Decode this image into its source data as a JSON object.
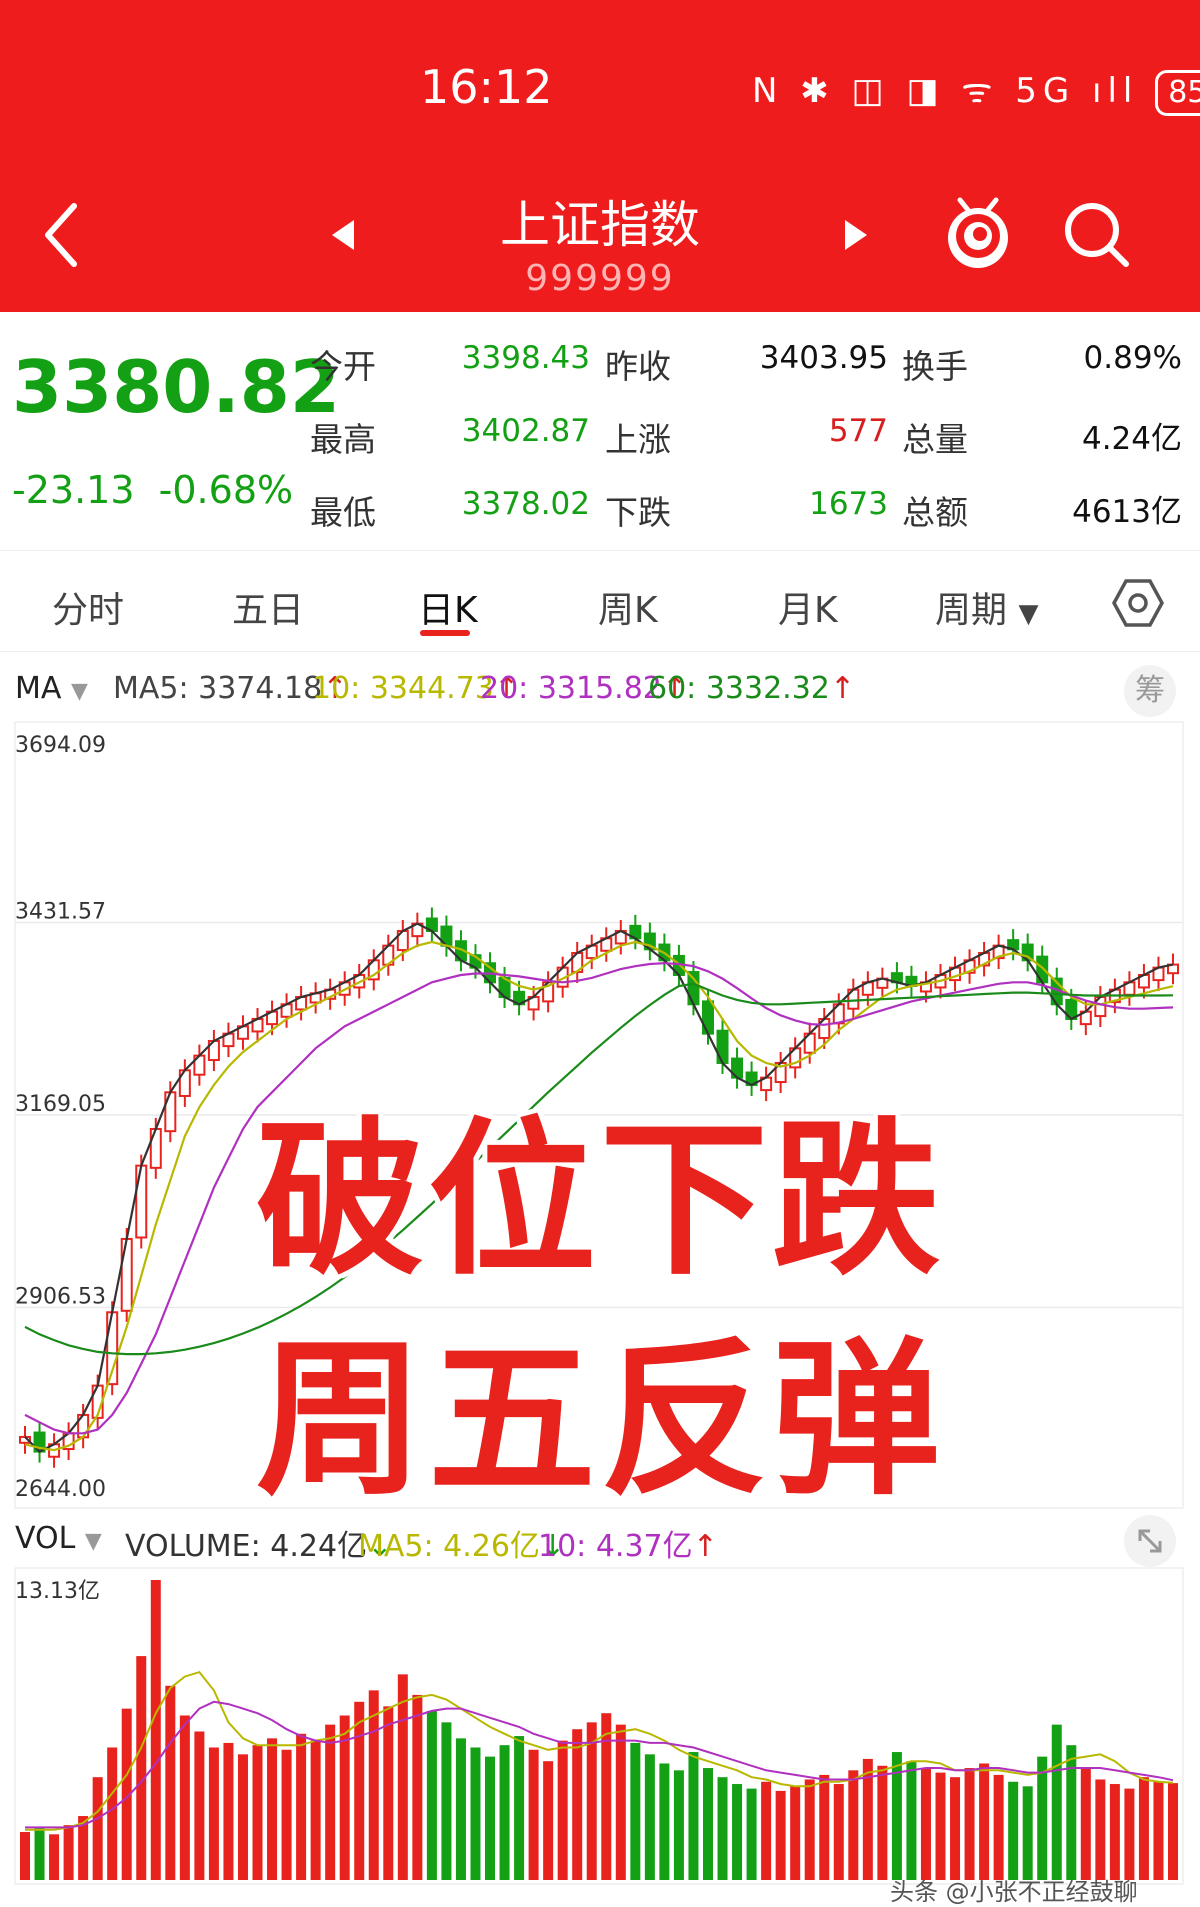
{
  "status_bar": {
    "time": "16:12",
    "icons": "N ✱ ◫ ◨ ᯤ 5G ıll",
    "battery": "85"
  },
  "header": {
    "title": "上证指数",
    "code": "999999"
  },
  "quote": {
    "price": "3380.82",
    "change": "-23.13",
    "change_pct": "-0.68%",
    "rows": [
      {
        "l1": "今开",
        "v1": "3398.43",
        "c1": "green",
        "l2": "昨收",
        "v2": "3403.95",
        "c2": "black",
        "l3": "换手",
        "v3": "0.89%",
        "c3": "black"
      },
      {
        "l1": "最高",
        "v1": "3402.87",
        "c1": "green",
        "l2": "上涨",
        "v2": "577",
        "c2": "red",
        "l3": "总量",
        "v3": "4.24亿",
        "c3": "black"
      },
      {
        "l1": "最低",
        "v1": "3378.02",
        "c1": "green",
        "l2": "下跌",
        "v2": "1673",
        "c2": "green",
        "l3": "总额",
        "v3": "4613亿",
        "c3": "black"
      }
    ]
  },
  "tabs": [
    {
      "label": "分时",
      "active": false
    },
    {
      "label": "五日",
      "active": false
    },
    {
      "label": "日K",
      "active": true
    },
    {
      "label": "周K",
      "active": false
    },
    {
      "label": "月K",
      "active": false
    },
    {
      "label": "周期",
      "active": false
    }
  ],
  "ma_legend": {
    "selector": "MA",
    "items": [
      {
        "text": "MA5: 3374.18",
        "color": "#444444"
      },
      {
        "text": "10: 3344.73",
        "color": "#b8b800"
      },
      {
        "text": "20: 3315.82",
        "color": "#b030c0"
      },
      {
        "text": "60: 3332.32",
        "color": "#1a8a1a"
      }
    ],
    "chip_button": "筹"
  },
  "vol_legend": {
    "selector": "VOL",
    "items": [
      {
        "text": "VOLUME: 4.24亿",
        "color": "#333333",
        "arrow": "↓",
        "arrow_color": "#14a014"
      },
      {
        "text": "MA5: 4.26亿",
        "color": "#b8b800",
        "arrow": "↓",
        "arrow_color": "#14a014"
      },
      {
        "text": "10: 4.37亿",
        "color": "#b030c0",
        "arrow": "↑",
        "arrow_color": "#d61f1f"
      }
    ]
  },
  "overlay": {
    "line1": "破位下跌",
    "line2": "周五反弹"
  },
  "watermark": "头条 @小张不正经鼓聊",
  "colors": {
    "up": "#e8231e",
    "down": "#14a014",
    "ma5": "#333333",
    "ma10": "#b8b800",
    "ma20": "#b030c0",
    "ma60": "#1a8a1a"
  },
  "chart_data": [
    {
      "type": "candlestick",
      "title": "",
      "y_ticks": [
        "3694.09",
        "3431.57",
        "3169.05",
        "2906.53",
        "2644.00"
      ],
      "ylim": [
        2644.0,
        3694.09
      ],
      "series": [
        {
          "name": "MA5",
          "values": [
            2730,
            2710,
            2720,
            2735,
            2760,
            2800,
            2900,
            3000,
            3100,
            3150,
            3200,
            3230,
            3250,
            3270,
            3280,
            3290,
            3300,
            3310,
            3320,
            3330,
            3335,
            3340,
            3350,
            3360,
            3380,
            3400,
            3420,
            3430,
            3420,
            3400,
            3380,
            3370,
            3350,
            3330,
            3320,
            3330,
            3350,
            3370,
            3390,
            3400,
            3410,
            3420,
            3410,
            3395,
            3380,
            3360,
            3320,
            3280,
            3240,
            3220,
            3210,
            3220,
            3240,
            3260,
            3280,
            3300,
            3320,
            3340,
            3350,
            3355,
            3350,
            3345,
            3350,
            3360,
            3370,
            3380,
            3390,
            3400,
            3395,
            3380,
            3350,
            3320,
            3300,
            3310,
            3330,
            3340,
            3350,
            3360,
            3370,
            3374.18
          ]
        },
        {
          "name": "MA10",
          "values": [
            2720,
            2715,
            2712,
            2718,
            2730,
            2760,
            2820,
            2880,
            2950,
            3020,
            3080,
            3140,
            3180,
            3210,
            3235,
            3255,
            3270,
            3285,
            3300,
            3310,
            3320,
            3330,
            3340,
            3350,
            3360,
            3375,
            3390,
            3400,
            3405,
            3400,
            3395,
            3385,
            3370,
            3355,
            3345,
            3340,
            3345,
            3355,
            3365,
            3380,
            3390,
            3400,
            3405,
            3400,
            3390,
            3375,
            3355,
            3330,
            3300,
            3270,
            3250,
            3240,
            3235,
            3240,
            3250,
            3265,
            3285,
            3300,
            3315,
            3330,
            3340,
            3345,
            3348,
            3352,
            3358,
            3365,
            3375,
            3385,
            3390,
            3385,
            3370,
            3350,
            3330,
            3320,
            3320,
            3325,
            3330,
            3335,
            3340,
            3344.73
          ]
        },
        {
          "name": "MA20",
          "values": [
            2760,
            2750,
            2740,
            2735,
            2735,
            2740,
            2760,
            2790,
            2830,
            2870,
            2920,
            2970,
            3020,
            3070,
            3110,
            3150,
            3180,
            3200,
            3220,
            3240,
            3260,
            3275,
            3290,
            3300,
            3310,
            3320,
            3330,
            3340,
            3350,
            3355,
            3360,
            3362,
            3362,
            3360,
            3358,
            3355,
            3352,
            3350,
            3352,
            3356,
            3362,
            3368,
            3372,
            3375,
            3376,
            3375,
            3372,
            3365,
            3355,
            3342,
            3328,
            3315,
            3305,
            3298,
            3293,
            3292,
            3295,
            3300,
            3306,
            3312,
            3318,
            3324,
            3328,
            3332,
            3336,
            3340,
            3344,
            3348,
            3350,
            3350,
            3346,
            3340,
            3332,
            3325,
            3320,
            3316,
            3314,
            3314,
            3315,
            3315.82
          ]
        },
        {
          "name": "MA60",
          "values": [
            2880,
            2870,
            2862,
            2855,
            2850,
            2846,
            2844,
            2843,
            2843,
            2844,
            2846,
            2849,
            2853,
            2858,
            2864,
            2871,
            2879,
            2888,
            2898,
            2909,
            2921,
            2934,
            2948,
            2963,
            2979,
            2995,
            3012,
            3030,
            3048,
            3067,
            3086,
            3105,
            3124,
            3143,
            3162,
            3181,
            3200,
            3218,
            3236,
            3254,
            3271,
            3288,
            3304,
            3319,
            3333,
            3345,
            3348,
            3340,
            3332,
            3326,
            3322,
            3320,
            3320,
            3321,
            3322,
            3323,
            3324,
            3325,
            3326,
            3327,
            3328,
            3329,
            3330,
            3331,
            3332,
            3333,
            3334,
            3335,
            3336,
            3336,
            3335,
            3334,
            3333,
            3332,
            3332,
            3332,
            3332,
            3332,
            3332,
            3332.32
          ]
        }
      ]
    },
    {
      "type": "bar",
      "title": "",
      "y_ticks": [
        "13.13亿"
      ],
      "ylim": [
        0,
        13.13
      ],
      "series": [
        {
          "name": "VOLUME",
          "values": [
            2.1,
            2.3,
            2.0,
            2.4,
            2.8,
            4.5,
            5.8,
            7.5,
            9.8,
            13.13,
            8.5,
            7.2,
            6.5,
            5.8,
            6.0,
            5.5,
            5.9,
            6.2,
            5.7,
            6.4,
            6.1,
            6.8,
            7.2,
            7.8,
            8.3,
            7.6,
            9.0,
            8.1,
            7.4,
            6.9,
            6.2,
            5.8,
            5.4,
            5.9,
            6.3,
            5.7,
            5.2,
            6.1,
            6.6,
            6.9,
            7.3,
            6.8,
            6.0,
            5.5,
            5.1,
            4.8,
            5.6,
            4.9,
            4.5,
            4.2,
            4.0,
            4.3,
            3.9,
            4.1,
            4.4,
            4.6,
            4.2,
            4.8,
            5.3,
            5.0,
            5.6,
            5.2,
            4.9,
            4.7,
            4.5,
            4.9,
            5.1,
            4.6,
            4.3,
            4.1,
            5.4,
            6.8,
            5.9,
            4.9,
            4.4,
            4.2,
            4.0,
            4.5,
            4.3,
            4.24
          ]
        },
        {
          "name": "MA5",
          "values": [
            2.2,
            2.2,
            2.2,
            2.3,
            2.5,
            3.0,
            3.8,
            4.6,
            5.8,
            7.3,
            8.4,
            8.9,
            9.1,
            8.3,
            6.9,
            6.2,
            5.9,
            5.9,
            5.9,
            5.9,
            6.1,
            6.2,
            6.4,
            6.9,
            7.2,
            7.5,
            7.8,
            8.0,
            8.1,
            7.9,
            7.5,
            7.1,
            6.7,
            6.4,
            6.1,
            5.9,
            5.7,
            5.8,
            5.8,
            6.0,
            6.4,
            6.5,
            6.6,
            6.4,
            6.1,
            5.7,
            5.4,
            5.2,
            5.0,
            4.8,
            4.5,
            4.4,
            4.2,
            4.1,
            4.1,
            4.3,
            4.3,
            4.4,
            4.7,
            4.8,
            5.0,
            5.2,
            5.2,
            5.1,
            4.8,
            4.8,
            4.8,
            4.8,
            4.7,
            4.6,
            4.7,
            5.0,
            5.3,
            5.4,
            5.5,
            5.2,
            4.7,
            4.4,
            4.3,
            4.26
          ]
        },
        {
          "name": "10",
          "values": [
            2.3,
            2.3,
            2.3,
            2.3,
            2.4,
            2.7,
            3.1,
            3.6,
            4.3,
            5.1,
            6.0,
            6.8,
            7.5,
            7.8,
            7.7,
            7.5,
            7.3,
            7.0,
            6.6,
            6.3,
            6.1,
            6.0,
            6.1,
            6.3,
            6.5,
            6.8,
            7.0,
            7.2,
            7.4,
            7.5,
            7.5,
            7.3,
            7.1,
            6.9,
            6.7,
            6.4,
            6.2,
            6.0,
            6.0,
            6.0,
            6.1,
            6.1,
            6.1,
            6.0,
            6.0,
            5.9,
            5.8,
            5.6,
            5.4,
            5.2,
            5.0,
            4.8,
            4.7,
            4.6,
            4.5,
            4.4,
            4.4,
            4.4,
            4.5,
            4.6,
            4.7,
            4.8,
            4.9,
            4.9,
            4.8,
            4.8,
            4.9,
            4.9,
            4.8,
            4.7,
            4.7,
            4.8,
            4.9,
            4.9,
            4.9,
            4.8,
            4.7,
            4.6,
            4.5,
            4.37
          ]
        }
      ]
    }
  ]
}
